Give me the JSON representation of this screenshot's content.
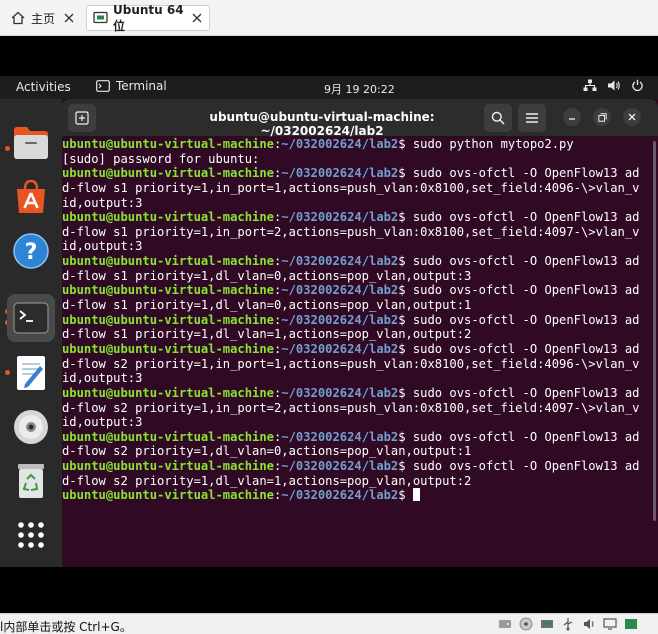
{
  "vmware": {
    "tabs": [
      {
        "label": "主页"
      },
      {
        "label": "Ubuntu 64 位"
      }
    ],
    "status_text": "l内部单击或按 Ctrl+G。"
  },
  "topbar": {
    "activities": "Activities",
    "app": "Terminal",
    "clock": "9月 19  20:22"
  },
  "dock": {
    "items": [
      {
        "name": "files-icon"
      },
      {
        "name": "app-store-icon"
      },
      {
        "name": "help-icon"
      },
      {
        "name": "terminal-icon"
      },
      {
        "name": "text-editor-icon"
      },
      {
        "name": "dvd-icon"
      },
      {
        "name": "trash-icon"
      },
      {
        "name": "app-grid-icon"
      }
    ]
  },
  "terminal": {
    "title": "ubuntu@ubuntu-virtual-machine: ~/032002624/lab2",
    "prompt_user": "ubuntu@ubuntu-virtual-machine",
    "prompt_sep": ":",
    "prompt_path": "~/032002624/lab2",
    "prompt_end": "$ ",
    "lines": [
      {
        "type": "prompt",
        "cmd": "sudo python mytopo2.py"
      },
      {
        "type": "out",
        "text": "[sudo] password for ubuntu:"
      },
      {
        "type": "prompt",
        "cmd": "sudo ovs-ofctl -O OpenFlow13 ad"
      },
      {
        "type": "out",
        "text": "d-flow s1 priority=1,in_port=1,actions=push_vlan:0x8100,set_field:4096-\\>vlan_v"
      },
      {
        "type": "out",
        "text": "id,output:3"
      },
      {
        "type": "prompt",
        "cmd": "sudo ovs-ofctl -O OpenFlow13 ad"
      },
      {
        "type": "out",
        "text": "d-flow s1 priority=1,in_port=2,actions=push_vlan:0x8100,set_field:4097-\\>vlan_v"
      },
      {
        "type": "out",
        "text": "id,output:3"
      },
      {
        "type": "prompt",
        "cmd": "sudo ovs-ofctl -O OpenFlow13 ad"
      },
      {
        "type": "out",
        "text": "d-flow s1 priority=1,dl_vlan=0,actions=pop_vlan,output:3"
      },
      {
        "type": "prompt",
        "cmd": "sudo ovs-ofctl -O OpenFlow13 ad"
      },
      {
        "type": "out",
        "text": "d-flow s1 priority=1,dl_vlan=0,actions=pop_vlan,output:1"
      },
      {
        "type": "prompt",
        "cmd": "sudo ovs-ofctl -O OpenFlow13 ad"
      },
      {
        "type": "out",
        "text": "d-flow s1 priority=1,dl_vlan=1,actions=pop_vlan,output:2"
      },
      {
        "type": "prompt",
        "cmd": "sudo ovs-ofctl -O OpenFlow13 ad"
      },
      {
        "type": "out",
        "text": "d-flow s2 priority=1,in_port=1,actions=push_vlan:0x8100,set_field:4096-\\>vlan_v"
      },
      {
        "type": "out",
        "text": "id,output:3"
      },
      {
        "type": "prompt",
        "cmd": "sudo ovs-ofctl -O OpenFlow13 ad"
      },
      {
        "type": "out",
        "text": "d-flow s2 priority=1,in_port=2,actions=push_vlan:0x8100,set_field:4097-\\>vlan_v"
      },
      {
        "type": "out",
        "text": "id,output:3"
      },
      {
        "type": "prompt",
        "cmd": "sudo ovs-ofctl -O OpenFlow13 ad"
      },
      {
        "type": "out",
        "text": "d-flow s2 priority=1,dl_vlan=0,actions=pop_vlan,output:1"
      },
      {
        "type": "prompt",
        "cmd": "sudo ovs-ofctl -O OpenFlow13 ad"
      },
      {
        "type": "out",
        "text": "d-flow s2 priority=1,dl_vlan=1,actions=pop_vlan,output:2"
      },
      {
        "type": "prompt",
        "cmd": ""
      }
    ]
  },
  "colors": {
    "terminal_bg": "#300a24",
    "prompt_user": "#8ae234",
    "prompt_path": "#729fcf",
    "accent": "#e95420"
  }
}
